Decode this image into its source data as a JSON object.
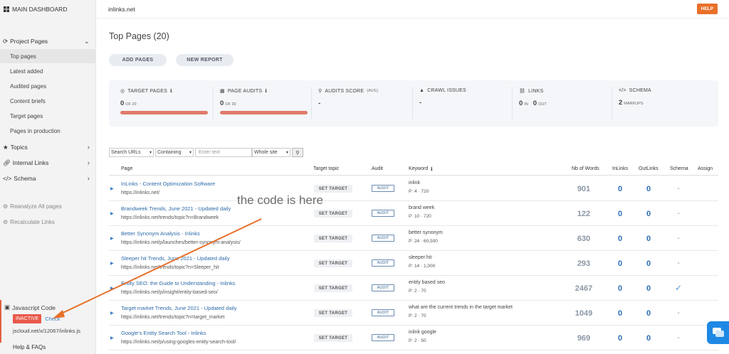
{
  "sidebar": {
    "main_dashboard": "MAIN DASHBOARD",
    "project_pages": "Project Pages",
    "subitems": [
      "Top pages",
      "Latest added",
      "Audited pages",
      "Content briefs",
      "Target pages",
      "Pages in production"
    ],
    "topics": "Topics",
    "internal_links": "Internal Links",
    "schema": "Schema",
    "reanalyze": "Reanalyze All pages",
    "recalculate": "Recalculate Links",
    "js_title": "Javascript Code",
    "js_status": "INACTIVE",
    "js_check": "Check",
    "js_url": "jscloud.net/x/12067/inlinks.js",
    "help": "Help & FAQs"
  },
  "header": {
    "site": "inlinks.net",
    "help": "HELP"
  },
  "page_title": "Top Pages (20)",
  "buttons": {
    "add_pages": "ADD PAGES",
    "new_report": "NEW REPORT"
  },
  "stats": {
    "target_pages": {
      "label": "TARGET PAGES",
      "value": "0",
      "sub": "OF 20"
    },
    "page_audits": {
      "label": "PAGE AUDITS",
      "value": "0",
      "sub": "OF 20"
    },
    "audits_score": {
      "label": "AUDITS SCORE",
      "sub_label": "(AVG)",
      "value": "-"
    },
    "crawl_issues": {
      "label": "CRAWL ISSUES",
      "value": "-"
    },
    "links": {
      "label": "LINKS",
      "in_value": "0",
      "in_label": "IN",
      "out_value": "0",
      "out_label": "OUT"
    },
    "schema": {
      "label": "SCHEMA",
      "value": "2",
      "sub": "MARKUPS"
    }
  },
  "filters": {
    "search_urls": "Search URLs",
    "containing": "Containing",
    "enter_text": "Enter text",
    "whole_site": "Whole site"
  },
  "table": {
    "headers": {
      "page": "Page",
      "target_topic": "Target topic",
      "audit": "Audit",
      "keyword": "Keyword",
      "nb_words": "Nb of Words",
      "inlinks": "InLinks",
      "outlinks": "OutLinks",
      "schema": "Schema",
      "assign": "Assign"
    },
    "set_target": "SET TARGET",
    "audit_label": "AUDIT",
    "rows": [
      {
        "title": "InLinks - Content Optimization Software",
        "url": "https://inlinks.net/",
        "kw": "inlink",
        "kw_meta": "P: 4 · 720",
        "words": "901",
        "in": "0",
        "out": "0",
        "schema": "-"
      },
      {
        "title": "Brandweek Trends, June 2021 - Updated daily",
        "url": "https://inlinks.net/trends/topic?n=Brandweek",
        "kw": "brand week",
        "kw_meta": "P: 10 · 720",
        "words": "122",
        "in": "0",
        "out": "0",
        "schema": "-"
      },
      {
        "title": "Better Synonym Analysis - Inlinks",
        "url": "https://inlinks.net/p/launches/better-synonym-analysis/",
        "kw": "better synonym",
        "kw_meta": "P: 24 · 60,500",
        "words": "630",
        "in": "0",
        "out": "0",
        "schema": "-"
      },
      {
        "title": "Sleeper hit Trends, June 2021 - Updated daily",
        "url": "https://inlinks.net/trends/topic?n=Sleeper_hit",
        "kw": "sleeper hit",
        "kw_meta": "P: 14 · 1,000",
        "words": "293",
        "in": "0",
        "out": "0",
        "schema": "-"
      },
      {
        "title": "Entity SEO: the Guide to Understanding - Inlinks",
        "url": "https://inlinks.net/p/insight/entity-based-seo/",
        "kw": "entity based seo",
        "kw_meta": "P: 2 · 70",
        "words": "2467",
        "in": "0",
        "out": "0",
        "schema": "✓"
      },
      {
        "title": "Target market Trends, June 2021 - Updated daily",
        "url": "https://inlinks.net/trends/topic?n=target_market",
        "kw": "what are the current trends in the target market",
        "kw_meta": "P: 2 · 70",
        "words": "1049",
        "in": "0",
        "out": "0",
        "schema": "-"
      },
      {
        "title": "Google's Entity Search Tool - Inlinks",
        "url": "https://inlinks.net/p/using-googles-entity-search-tool/",
        "kw": "inlink google",
        "kw_meta": "P: 2 · 50",
        "words": "969",
        "in": "0",
        "out": "0",
        "schema": "-"
      }
    ]
  },
  "annotation": {
    "text": "the code is here",
    "color": "#e8702a"
  }
}
